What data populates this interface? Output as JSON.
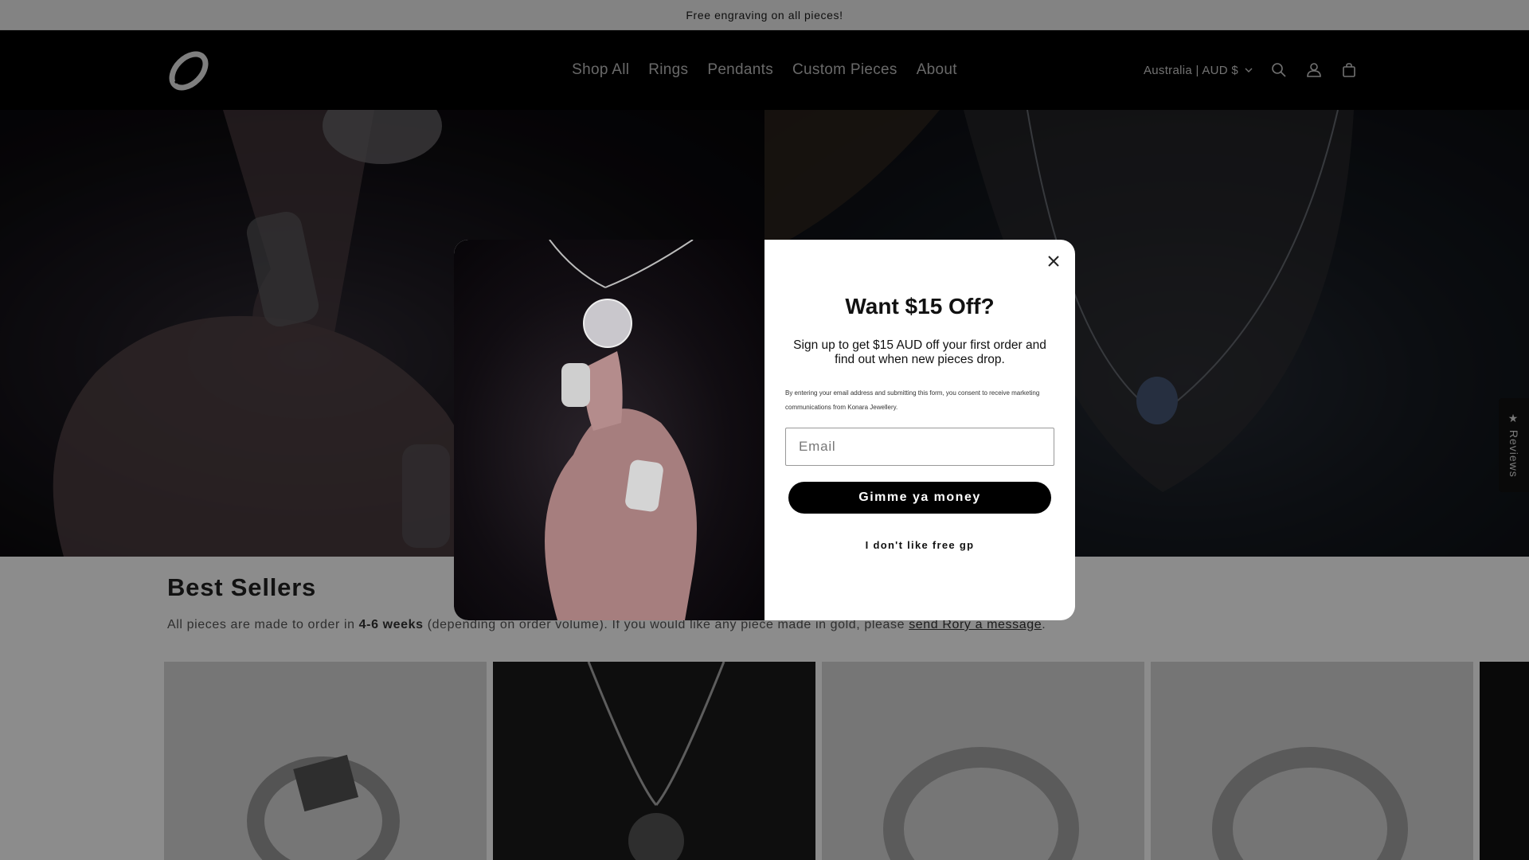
{
  "announcement": "Free engraving on all pieces!",
  "header": {
    "logo_icon": "brand-logo-icon",
    "nav": [
      "Shop All",
      "Rings",
      "Pendants",
      "Custom Pieces",
      "About"
    ],
    "country": "Australia | AUD $",
    "icons": [
      "search-icon",
      "account-icon",
      "cart-icon"
    ]
  },
  "reviews_tab": "★ Reviews",
  "best_sellers": {
    "title": "Best Sellers",
    "desc_prefix": "All pieces are made to order in ",
    "desc_bold": "4-6 weeks",
    "desc_middle": " (depending on order volume). If you would like any piece made in gold, please ",
    "desc_link": "send Rory a message",
    "desc_suffix": "."
  },
  "popup": {
    "title": "Want $15 Off?",
    "subtitle": "Sign up to get $15 AUD off your first order and find out when new pieces drop.",
    "fine_print": "By entering your email address and submitting this form, you consent to receive marketing communications from Konara Jewellery.",
    "email_placeholder": "Email",
    "submit_label": "Gimme ya money",
    "decline_label": "I don't like free gp"
  },
  "colors": {
    "accent": "#000000",
    "announce_bg": "#efefef"
  }
}
